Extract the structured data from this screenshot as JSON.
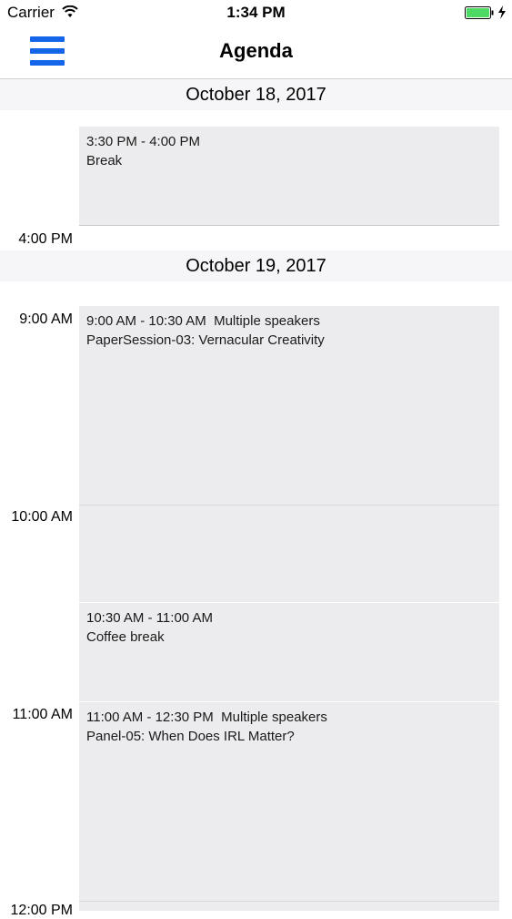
{
  "status_bar": {
    "carrier": "Carrier",
    "time": "1:34 PM"
  },
  "nav": {
    "title": "Agenda"
  },
  "days": [
    {
      "header": "October 18, 2017",
      "time_labels": [
        "4:00 PM"
      ],
      "events": [
        {
          "time": "3:30 PM - 4:00 PM",
          "speakers": "",
          "title": "Break"
        }
      ]
    },
    {
      "header": "October 19, 2017",
      "time_labels": [
        "9:00 AM",
        "10:00 AM",
        "11:00 AM",
        "12:00 PM"
      ],
      "events": [
        {
          "time": "9:00 AM - 10:30 AM",
          "speakers": "Multiple speakers",
          "title": "PaperSession-03: Vernacular Creativity"
        },
        {
          "time": "10:30 AM - 11:00 AM",
          "speakers": "",
          "title": "Coffee break"
        },
        {
          "time": "11:00 AM - 12:30 PM",
          "speakers": "Multiple speakers",
          "title": "Panel-05: When Does IRL Matter?"
        }
      ]
    }
  ],
  "colors": {
    "accent": "#1565e8",
    "event_background": "#ececee",
    "header_background": "#f6f6f8",
    "battery": "#4cd964"
  }
}
